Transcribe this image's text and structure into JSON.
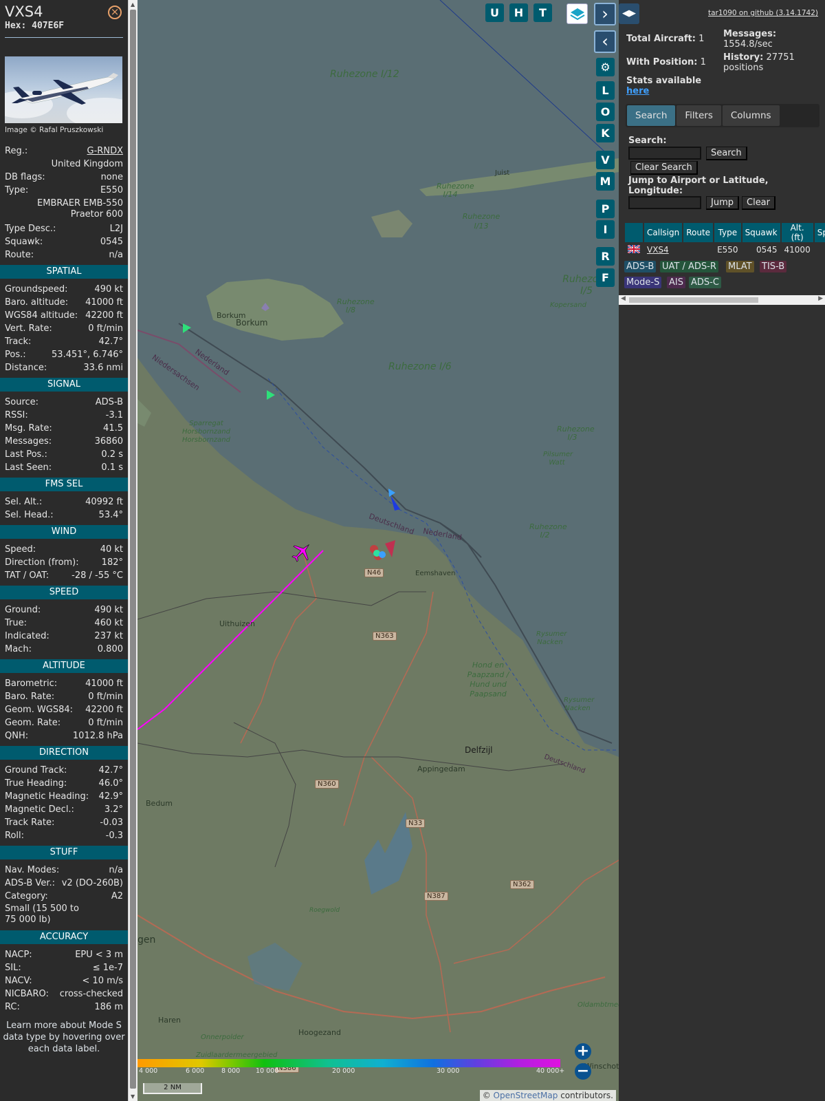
{
  "sidebar": {
    "callsign": "VXS4",
    "hex_label": "Hex: 407E6F",
    "photo_credit": "Image © Rafal Pruszkowski",
    "info_rows": [
      {
        "k": "Reg.:",
        "v": "G-RNDX"
      },
      {
        "k": "",
        "v": "United Kingdom"
      },
      {
        "k": "DB flags:",
        "v": "none"
      },
      {
        "k": "Type:",
        "v": "E550"
      },
      {
        "k": "",
        "v": "EMBRAER EMB-550 Praetor 600"
      },
      {
        "k": "Type Desc.:",
        "v": "L2J"
      },
      {
        "k": "Squawk:",
        "v": "0545"
      },
      {
        "k": "Route:",
        "v": "n/a"
      }
    ],
    "sections": [
      {
        "title": "SPATIAL",
        "rows": [
          {
            "k": "Groundspeed:",
            "v": "490 kt"
          },
          {
            "k": "Baro. altitude:",
            "v": "41000 ft"
          },
          {
            "k": "WGS84 altitude:",
            "v": "42200 ft"
          },
          {
            "k": "Vert. Rate:",
            "v": "0 ft/min"
          },
          {
            "k": "Track:",
            "v": "42.7°"
          },
          {
            "k": "Pos.:",
            "v": "53.451°, 6.746°"
          },
          {
            "k": "Distance:",
            "v": "33.6 nmi"
          }
        ]
      },
      {
        "title": "SIGNAL",
        "rows": [
          {
            "k": "Source:",
            "v": "ADS-B"
          },
          {
            "k": "RSSI:",
            "v": "-3.1"
          },
          {
            "k": "Msg. Rate:",
            "v": "41.5"
          },
          {
            "k": "Messages:",
            "v": "36860"
          },
          {
            "k": "Last Pos.:",
            "v": "0.2 s"
          },
          {
            "k": "Last Seen:",
            "v": "0.1 s"
          }
        ]
      },
      {
        "title": "FMS SEL",
        "rows": [
          {
            "k": "Sel. Alt.:",
            "v": "40992 ft"
          },
          {
            "k": "Sel. Head.:",
            "v": "53.4°"
          }
        ]
      },
      {
        "title": "WIND",
        "rows": [
          {
            "k": "Speed:",
            "v": "40 kt"
          },
          {
            "k": "Direction (from):",
            "v": "182°"
          },
          {
            "k": "TAT / OAT:",
            "v": "-28 / -55 °C"
          }
        ]
      },
      {
        "title": "SPEED",
        "rows": [
          {
            "k": "Ground:",
            "v": "490 kt"
          },
          {
            "k": "True:",
            "v": "460 kt"
          },
          {
            "k": "Indicated:",
            "v": "237 kt"
          },
          {
            "k": "Mach:",
            "v": "0.800"
          }
        ]
      },
      {
        "title": "ALTITUDE",
        "rows": [
          {
            "k": "Barometric:",
            "v": "41000 ft"
          },
          {
            "k": "Baro. Rate:",
            "v": "0 ft/min"
          },
          {
            "k": "Geom. WGS84:",
            "v": "42200 ft"
          },
          {
            "k": "Geom. Rate:",
            "v": "0 ft/min"
          },
          {
            "k": "QNH:",
            "v": "1012.8 hPa"
          }
        ]
      },
      {
        "title": "DIRECTION",
        "rows": [
          {
            "k": "Ground Track:",
            "v": "42.7°"
          },
          {
            "k": "True Heading:",
            "v": "46.0°"
          },
          {
            "k": "Magnetic Heading:",
            "v": "42.9°"
          },
          {
            "k": "Magnetic Decl.:",
            "v": "3.2°"
          },
          {
            "k": "Track Rate:",
            "v": "-0.03"
          },
          {
            "k": "Roll:",
            "v": "-0.3"
          }
        ]
      },
      {
        "title": "STUFF",
        "rows": [
          {
            "k": "Nav. Modes:",
            "v": "n/a"
          },
          {
            "k": "ADS-B Ver.:",
            "v": "v2 (DO-260B)"
          },
          {
            "k": "Category:",
            "v": "A2"
          },
          {
            "k": "Small (15 500 to 75 000 lb)",
            "v": ""
          }
        ]
      },
      {
        "title": "ACCURACY",
        "rows": [
          {
            "k": "NACP:",
            "v": "EPU < 3 m"
          },
          {
            "k": "SIL:",
            "v": "≤ 1e-7"
          },
          {
            "k": "NACV:",
            "v": "< 10 m/s"
          },
          {
            "k": "NICBARO:",
            "v": "cross-checked"
          },
          {
            "k": "RC:",
            "v": "186 m"
          }
        ]
      }
    ],
    "footer_note": "Learn more about Mode S data type by hovering over each data label."
  },
  "map": {
    "layer_buttons": [
      "U",
      "H",
      "T"
    ],
    "side_buttons": [
      "L",
      "O",
      "K",
      "V",
      "M",
      "P",
      "I",
      "R",
      "F"
    ],
    "labels": {
      "ruhezone_i12": "Ruhezone I/12",
      "ruhezone_i6": "Ruhezone I/6",
      "ruhezone_i14": "Ruhezone I/14",
      "ruhezone_i13": "Ruhezone I/13",
      "ruhezone_i8": "Ruhezone I/8",
      "ruhezone_i3": "Ruhezone I/3",
      "ruhezone_i2": "Ruhezone I/2",
      "ruhezone_i5": "Ruhezone I/5",
      "juist": "Juist",
      "borkum_a": "Borkum",
      "borkum_b": "Borkum",
      "nederland_a": "Nederland",
      "niedersachsen": "Niedersachsen",
      "sparregat": "Sparregat Horsbornzand Horsbornzand",
      "deutschland_a": "Deutschland",
      "nederland_b": "Nederland",
      "kopersand": "Kopersand",
      "pilsumer_watt": "Pilsumer Watt",
      "eemshaven": "Eemshaven",
      "uithuizen": "Uithuizen",
      "rysumer_nacken_a": "Rysumer Nacken",
      "rysumer_nacken_b": "Rysumer Nacken",
      "hond_paapzand": "Hond en Paapzand / Hund und Paapsand",
      "delfzijl": "Delfzijl",
      "appingedam": "Appingedam",
      "deutschland_b": "Deutschland",
      "bedum": "Bedum",
      "roegwold": "Roegwold",
      "gen": "gen",
      "haren": "Haren",
      "hoogezand": "Hoogezand",
      "onnerpolder": "Onnerpolder",
      "oldambtmeer": "Oldambtmeer",
      "winschoten": "Winschoten",
      "zuidlaardermeergebied": "Zuidlaardermeergebied"
    },
    "roads": [
      "N46",
      "N363",
      "N360",
      "N33",
      "N387",
      "N362",
      "N386"
    ],
    "altitude_scale": [
      "4 000",
      "6 000",
      "8 000",
      "10 000",
      "20 000",
      "30 000",
      "40 000+"
    ],
    "scale_label": "2 NM",
    "attribution_prefix": "© ",
    "attribution_link": "OpenStreetMap",
    "attribution_suffix": " contributors.",
    "track_color": "#ff00ff"
  },
  "panel": {
    "github_link": "tar1090 on github (3.14.1742)",
    "total_aircraft_label": "Total Aircraft:",
    "total_aircraft_value": "1",
    "with_position_label": "With Position:",
    "with_position_value": "1",
    "stats_label": "Stats available",
    "stats_link": "here",
    "messages_label": "Messages:",
    "messages_value": "1554.8/sec",
    "history_label": "History:",
    "history_value": "27751 positions",
    "tabs": [
      "Search",
      "Filters",
      "Columns"
    ],
    "search_label": "Search:",
    "search_button": "Search",
    "clear_search_button": "Clear Search",
    "jump_label": "Jump to Airport or Latitude, Longitude:",
    "jump_button": "Jump",
    "clear_button": "Clear",
    "table_headers": [
      "",
      "Callsign",
      "Route",
      "Type",
      "Squawk",
      "Alt. (ft)",
      "Spd."
    ],
    "table_row": {
      "callsign": "VXS4",
      "route": "",
      "type": "E550",
      "squawk": "0545",
      "alt": "41000",
      "spd": "4"
    },
    "legend": [
      {
        "label": "ADS-B",
        "bg": "#1f4f66"
      },
      {
        "label": "UAT / ADS-R",
        "bg": "#25553b"
      },
      {
        "label": "MLAT",
        "bg": "#5f5128"
      },
      {
        "label": "TIS-B",
        "bg": "#5b2a3d"
      },
      {
        "label": "Mode-S",
        "bg": "#3a3578"
      },
      {
        "label": "AIS",
        "bg": "#4d2a4d"
      },
      {
        "label": "ADS-C",
        "bg": "#2e5a45"
      }
    ]
  }
}
